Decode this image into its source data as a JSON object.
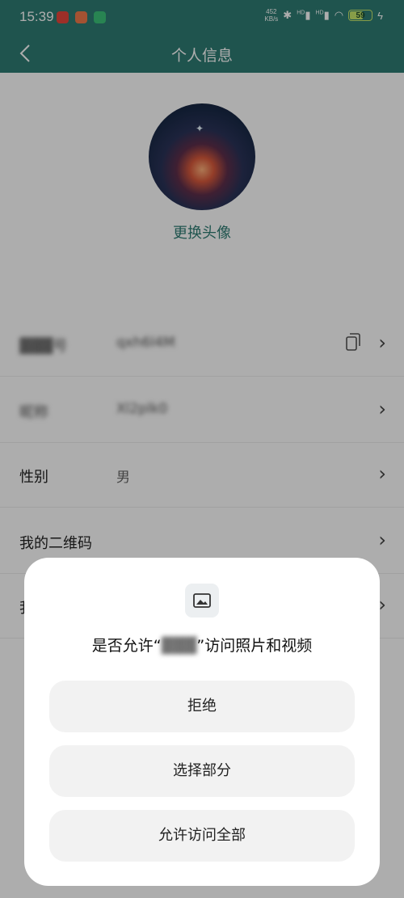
{
  "status_bar": {
    "time": "15:39",
    "net_speed_value": "452",
    "net_speed_unit": "KB/s",
    "signal_1_label": "HD",
    "signal_2_label": "HD",
    "battery_level": "59",
    "icons": [
      "app-red-icon",
      "app-orange-icon",
      "app-green-icon",
      "bluetooth-icon",
      "signal-icon",
      "signal-icon",
      "wifi-icon",
      "battery-icon",
      "charging-icon"
    ]
  },
  "nav": {
    "back_icon": "back-chevron-icon",
    "title": "个人信息"
  },
  "profile": {
    "change_avatar_label": "更换头像"
  },
  "rows": [
    {
      "label": "▓▓▓号",
      "value": "qxh6l4M"
    },
    {
      "label": "昵称",
      "value": "Xl2plk0"
    },
    {
      "label": "性别",
      "value": "男"
    },
    {
      "label": "我的二维码",
      "value": ""
    },
    {
      "label": "我",
      "value": ""
    }
  ],
  "dialog": {
    "icon": "image-icon",
    "title_prefix": "是否允许“",
    "title_app": "▓▓▓",
    "title_suffix": "”访问照片和视频",
    "buttons": {
      "deny": "拒绝",
      "select_partial": "选择部分",
      "allow_all": "允许访问全部"
    }
  },
  "colors": {
    "header": "#2e7d73",
    "accent_text": "#2e7d73",
    "battery": "#c8e86a"
  }
}
